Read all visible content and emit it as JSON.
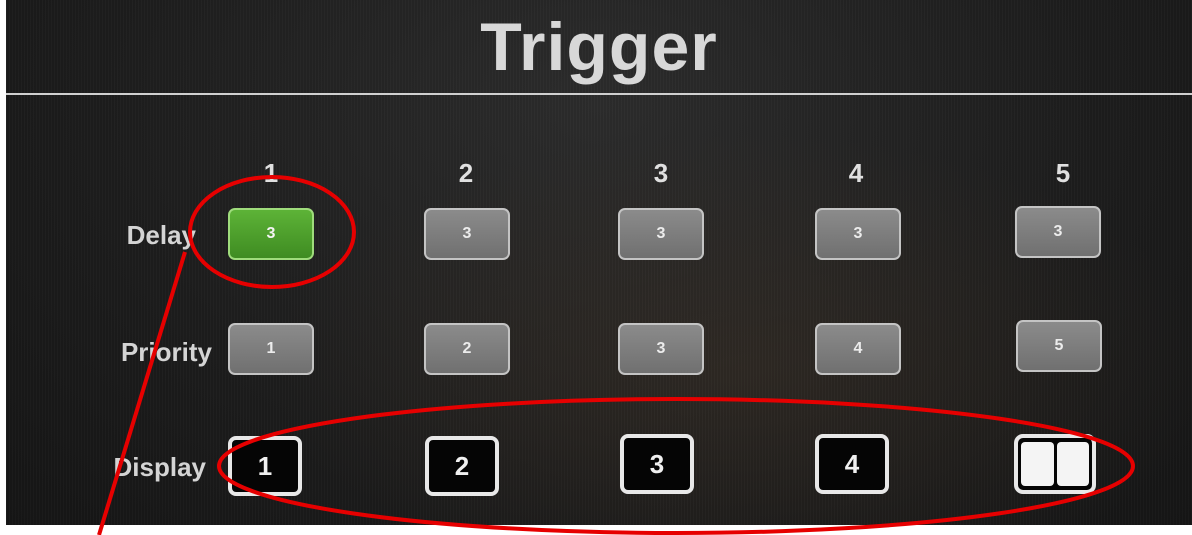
{
  "title": "Trigger",
  "columns": [
    "1",
    "2",
    "3",
    "4",
    "5"
  ],
  "rows": {
    "delay": {
      "label": "Delay",
      "values": [
        "3",
        "3",
        "3",
        "3",
        "3"
      ],
      "selected_index": 0
    },
    "priority": {
      "label": "Priority",
      "values": [
        "1",
        "2",
        "3",
        "4",
        "5"
      ]
    },
    "display": {
      "label": "Display",
      "values": [
        "1",
        "2",
        "3",
        "4",
        ""
      ],
      "last_icon": "split-screen-icon"
    }
  },
  "colors": {
    "selected": "#4fa22c",
    "button_gray": "#7d7d7d",
    "display_button": "#050505",
    "annotation": "#e60000"
  }
}
